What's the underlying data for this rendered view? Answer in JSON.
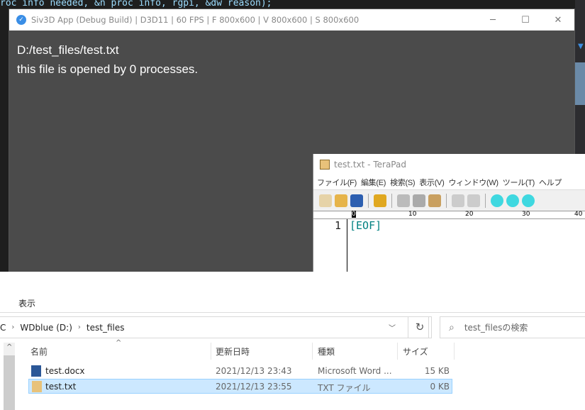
{
  "code_editor": {
    "line": "roc info needed, &n proc info, rgpi, &dw reason);"
  },
  "siv3d": {
    "title": "Siv3D App (Debug Build) | D3D11 | 60 FPS | F 800x600 | V 800x600 | S 800x600",
    "path": "D:/test_files/test.txt",
    "message": "this file is opened by 0 processes.",
    "controls": {
      "minimize": "─",
      "maximize": "☐",
      "close": "✕"
    }
  },
  "terapad": {
    "title": "test.txt - TeraPad",
    "menu": [
      "ファイル(F)",
      "編集(E)",
      "検索(S)",
      "表示(V)",
      "ウィンドウ(W)",
      "ツール(T)",
      "ヘルプ"
    ],
    "ruler": [
      "0",
      "10",
      "20",
      "30",
      "40"
    ],
    "line_number": "1",
    "content": "[EOF]"
  },
  "explorer": {
    "ribbon_tab": "表示",
    "breadcrumb": [
      "C",
      "WDblue (D:)",
      "test_files"
    ],
    "search_placeholder": "test_filesの検索",
    "columns": [
      "名前",
      "更新日時",
      "種類",
      "サイズ"
    ],
    "files": [
      {
        "name": "test.docx",
        "modified": "2021/12/13 23:43",
        "type": "Microsoft Word ...",
        "size": "15 KB",
        "icon": "word-doc-icon",
        "selected": false
      },
      {
        "name": "test.txt",
        "modified": "2021/12/13 23:55",
        "type": "TXT ファイル",
        "size": "0 KB",
        "icon": "terapad-txt-icon",
        "selected": true
      }
    ]
  },
  "colors": {
    "siv_bg": "#4b4b4b",
    "selection": "#cce8ff",
    "eof": "#008080"
  }
}
